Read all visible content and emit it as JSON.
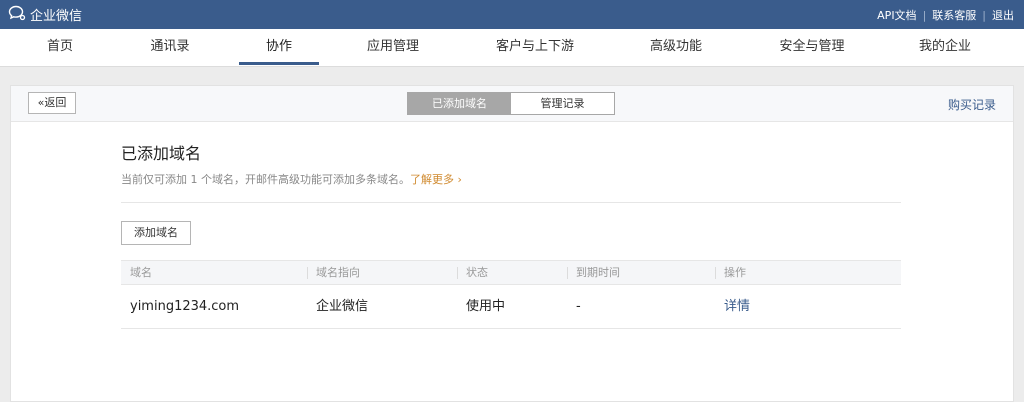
{
  "topbar": {
    "brand": "企业微信",
    "api_doc": "API文档",
    "contact": "联系客服",
    "logout": "退出",
    "separator": "|"
  },
  "nav": {
    "items": [
      "首页",
      "通讯录",
      "协作",
      "应用管理",
      "客户与上下游",
      "高级功能",
      "安全与管理",
      "我的企业"
    ],
    "active": "协作"
  },
  "panel": {
    "back": "«返回",
    "tabs": [
      "已添加域名",
      "管理记录"
    ],
    "active_tab": "已添加域名",
    "buy_record": "购买记录",
    "title": "已添加域名",
    "subtitle": "当前仅可添加 1 个域名，开邮件高级功能可添加多条域名。",
    "learn_more": "了解更多 ›",
    "add_button": "添加域名"
  },
  "table": {
    "headers": [
      "域名",
      "域名指向",
      "状态",
      "到期时间",
      "操作"
    ],
    "rows": [
      [
        "yiming1234.com",
        "企业微信",
        "使用中",
        "-",
        "详情"
      ]
    ]
  },
  "colors": {
    "topbar": "#3a5c8c",
    "link": "#3a5c8c",
    "learn_more": "#d08a2f",
    "tab_active": "#a7a7a7"
  }
}
